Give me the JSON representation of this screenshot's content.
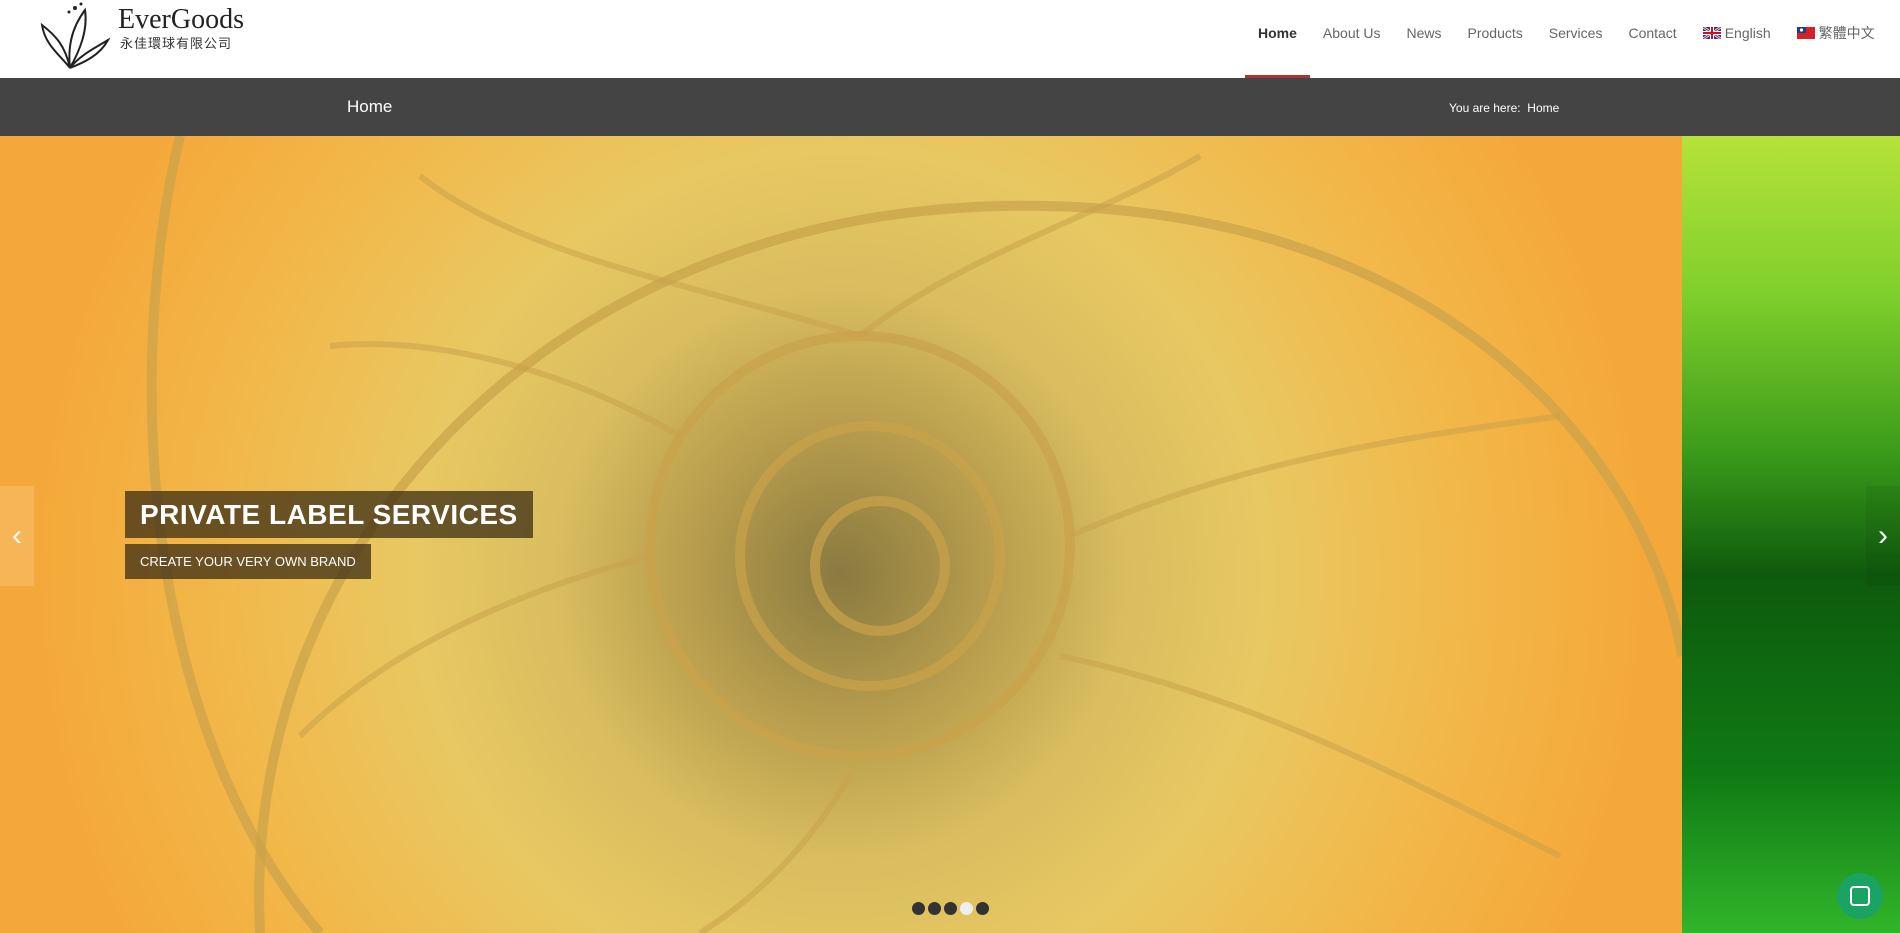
{
  "logo": {
    "name": "EverGoods",
    "subname": "永佳環球有限公司"
  },
  "nav": {
    "items": [
      {
        "label": "Home",
        "active": true
      },
      {
        "label": "About Us"
      },
      {
        "label": "News"
      },
      {
        "label": "Products"
      },
      {
        "label": "Services"
      },
      {
        "label": "Contact"
      }
    ],
    "languages": [
      {
        "label": "English",
        "flag": "uk-flag-icon"
      },
      {
        "label": "繁體中文",
        "flag": "taiwan-flag-icon"
      }
    ]
  },
  "page": {
    "title": "Home",
    "breadcrumb_prefix": "You are here:",
    "breadcrumb_current": "Home"
  },
  "slider": {
    "caption_title": "PRIVATE LABEL SERVICES",
    "caption_subtitle": "CREATE YOUR VERY OWN BRAND",
    "dots": 5,
    "active_dot": 4
  },
  "colors": {
    "accent": "#a33333",
    "titlebar": "#444444",
    "chat": "#1aa362"
  }
}
